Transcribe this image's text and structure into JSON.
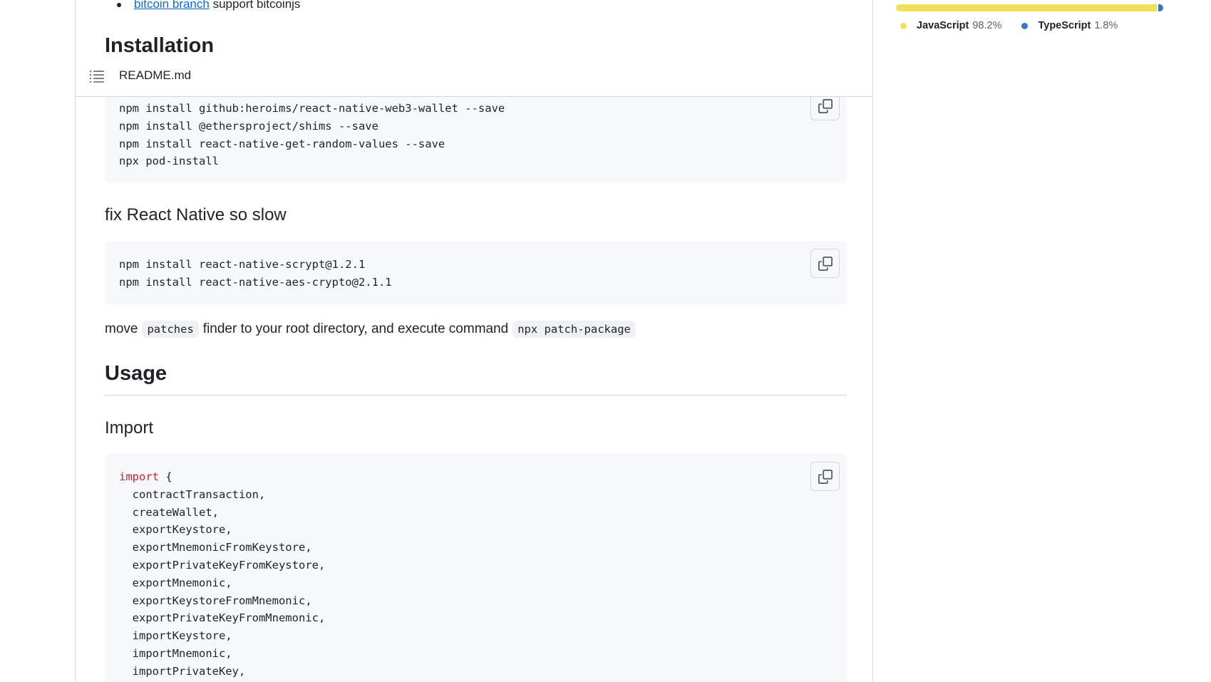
{
  "readme_header": {
    "title": "README.md",
    "toc_icon": "list-unordered-icon"
  },
  "content": {
    "bullet_link": "bitcoin branch",
    "bullet_text": "support bitcoinjs",
    "installation_heading": "Installation",
    "install_code": [
      "npm install github:heroims/react-native-web3-wallet --save",
      "npm install @ethersproject/shims --save",
      "npm install react-native-get-random-values --save",
      "npx pod-install"
    ],
    "fix_heading": "fix React Native so slow",
    "fix_code": [
      "npm install react-native-scrypt@1.2.1",
      "npm install react-native-aes-crypto@2.1.1"
    ],
    "para_move": "move",
    "para_code1": "patches",
    "para_middle": "finder to your root directory, and execute command",
    "para_code2": "npx patch-package",
    "usage_heading": "Usage",
    "import_heading": "Import",
    "import_keyword": "import",
    "import_brace": " {",
    "import_code": [
      "  contractTransaction,",
      "  createWallet,",
      "  exportKeystore,",
      "  exportMnemonicFromKeystore,",
      "  exportPrivateKeyFromKeystore,",
      "  exportMnemonic,",
      "  exportKeystoreFromMnemonic,",
      "  exportPrivateKeyFromMnemonic,",
      "  importKeystore,",
      "  importMnemonic,",
      "  importPrivateKey,"
    ],
    "copy_icon": "copy-icon"
  },
  "languages": [
    {
      "name": "JavaScript",
      "percent": "98.2%",
      "value": 98.2,
      "color": "#f1e05a"
    },
    {
      "name": "TypeScript",
      "percent": "1.8%",
      "value": 1.8,
      "color": "#3178c6"
    }
  ]
}
